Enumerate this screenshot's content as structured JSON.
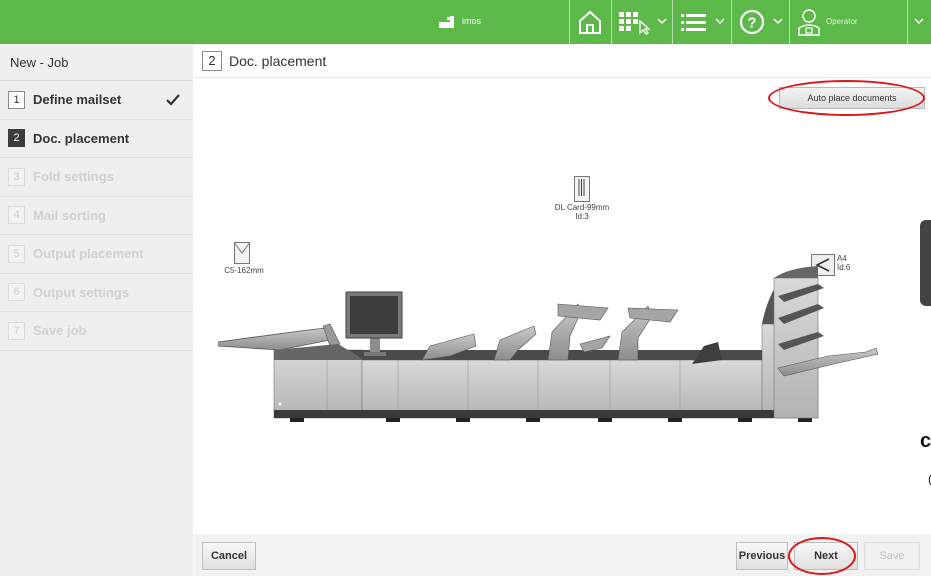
{
  "topbar": {
    "brand_label": "imos",
    "operator_label": "Operator",
    "background_color": "#5db84a",
    "icons": [
      "brand-logo-icon",
      "home-icon",
      "apps-icon",
      "menu-list-icon",
      "help-icon",
      "operator-icon",
      "chevron-down-icon"
    ]
  },
  "sidebar": {
    "title": "New - Job",
    "steps": [
      {
        "num": "1",
        "label": "Define mailset",
        "state": "done"
      },
      {
        "num": "2",
        "label": "Doc. placement",
        "state": "active"
      },
      {
        "num": "3",
        "label": "Fold settings",
        "state": "disabled"
      },
      {
        "num": "4",
        "label": "Mail sorting",
        "state": "disabled"
      },
      {
        "num": "5",
        "label": "Output placement",
        "state": "disabled"
      },
      {
        "num": "6",
        "label": "Output settings",
        "state": "disabled"
      },
      {
        "num": "7",
        "label": "Save job",
        "state": "disabled"
      }
    ]
  },
  "main": {
    "step_num": "2",
    "title": "Doc. placement",
    "auto_place_label": "Auto place documents",
    "documents": [
      {
        "name": "DL Card-99mm",
        "id": "Id:3"
      },
      {
        "name": "C5-162mm",
        "id": ""
      },
      {
        "name": "A4",
        "id": "Id:6"
      }
    ],
    "edge_glyph": "c",
    "edge_glyph2": "("
  },
  "footer": {
    "cancel_label": "Cancel",
    "previous_label": "Previous",
    "next_label": "Next",
    "save_label": "Save"
  },
  "annotation_color": "#e01515"
}
